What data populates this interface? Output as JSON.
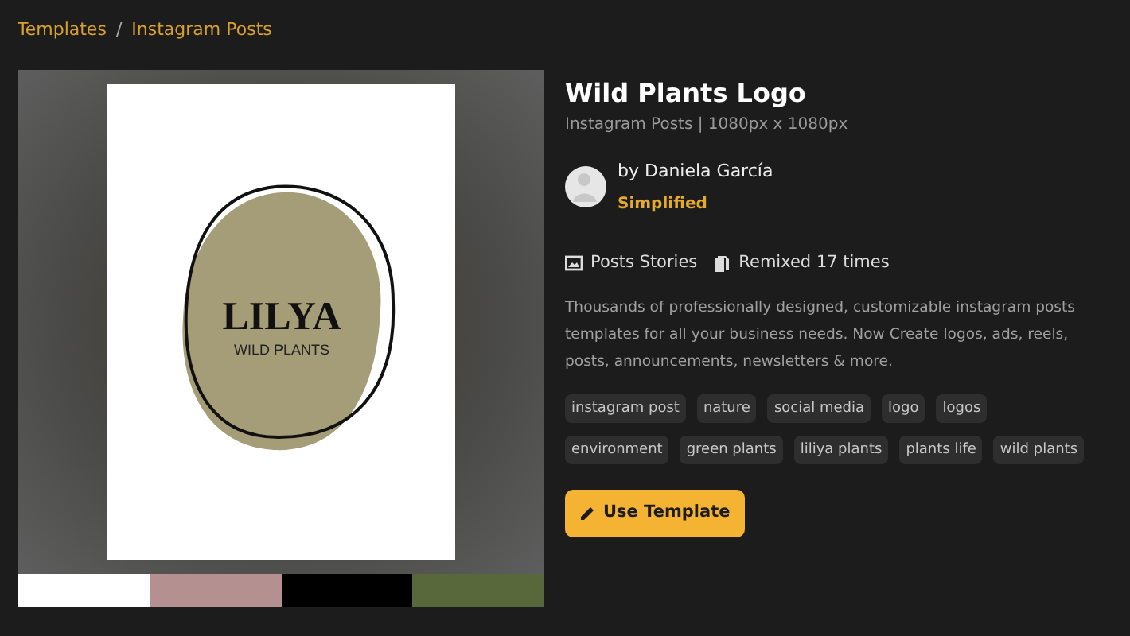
{
  "breadcrumb": [
    {
      "label": "Templates"
    },
    {
      "label": "Instagram Posts"
    }
  ],
  "breadcrumb_separator": "/",
  "preview": {
    "logo_title": "LILYA",
    "logo_subtitle": "WILD PLANTS"
  },
  "swatches": [
    {
      "color": "#ffffff"
    },
    {
      "color": "#b59090"
    },
    {
      "color": "#000000"
    },
    {
      "color": "#59683a"
    }
  ],
  "title": "Wild Plants Logo",
  "subtitle": "Instagram Posts | 1080px x 1080px",
  "author": {
    "name": "by Daniela García",
    "team": "Simplified"
  },
  "stats": [
    {
      "kind": "image",
      "label": "Posts Stories"
    },
    {
      "kind": "copies",
      "label": "Remixed 17 times"
    }
  ],
  "description": "Thousands of professionally designed, customizable instagram posts templates for all your business needs. Now Create logos, ads, reels, posts, announcements, newsletters & more.",
  "tags": [
    {
      "label": "instagram post"
    },
    {
      "label": "nature"
    },
    {
      "label": "social media"
    },
    {
      "label": "logo"
    },
    {
      "label": "logos"
    },
    {
      "label": "environment"
    },
    {
      "label": "green plants"
    },
    {
      "label": "liliya plants"
    },
    {
      "label": "plants life"
    },
    {
      "label": "wild plants"
    }
  ],
  "button": {
    "label": "Use Template"
  }
}
